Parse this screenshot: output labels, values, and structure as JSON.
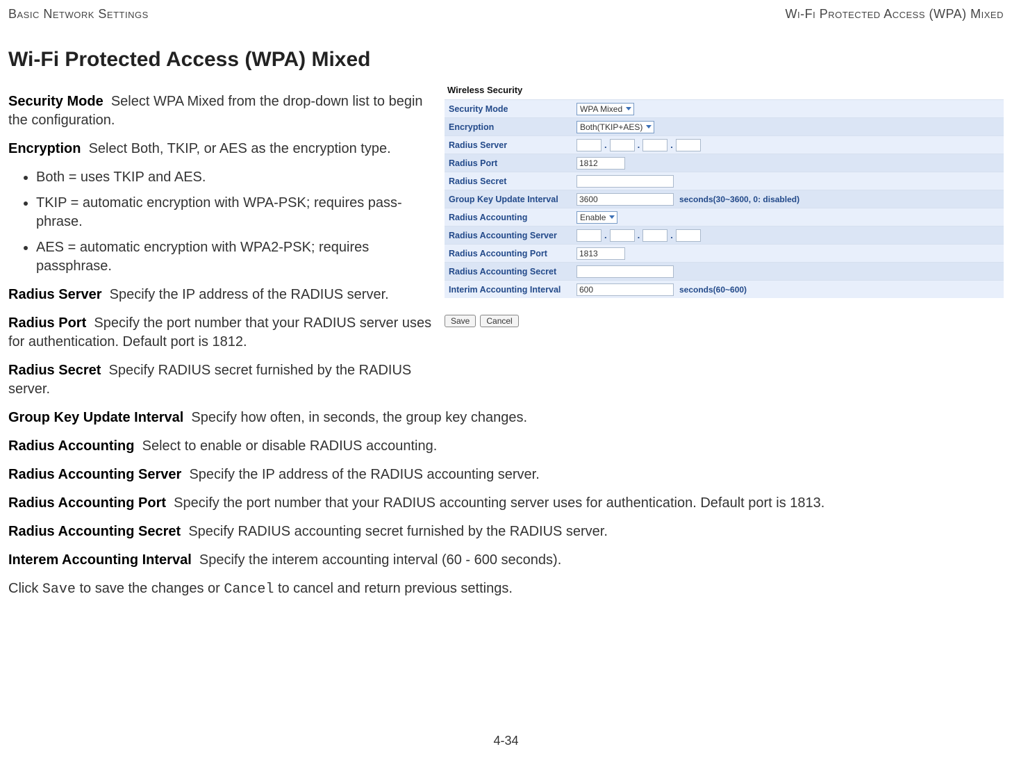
{
  "header": {
    "left": "Basic Network Settings",
    "right": "Wi-Fi Protected Access (WPA) Mixed"
  },
  "title": "Wi-Fi Protected Access (WPA) Mixed",
  "definitions": {
    "security_mode": {
      "term": "Security Mode",
      "desc": "Select WPA Mixed from the drop-down list to begin the configuration."
    },
    "encryption": {
      "term": "Encryption",
      "desc": "Select Both, TKIP, or AES as the encryption type."
    },
    "enc_items": [
      "Both = uses TKIP and AES.",
      "TKIP = automatic encryption with WPA-PSK; requires pass-phrase.",
      "AES = automatic encryption with WPA2-PSK; requires passphrase."
    ],
    "radius_server": {
      "term": "Radius Server",
      "desc": "Specify the IP address of the RADIUS server."
    },
    "radius_port": {
      "term": "Radius Port",
      "desc": "Specify the port number that your RADIUS server uses for authentication. Default port is 1812."
    },
    "radius_secret": {
      "term": "Radius Secret",
      "desc": "Specify RADIUS secret furnished by the RADIUS server."
    },
    "group_key": {
      "term": "Group Key Update Interval",
      "desc": "Specify how often, in seconds, the group key changes."
    },
    "radius_acct": {
      "term": "Radius Accounting",
      "desc": "Select to enable or disable RADIUS accounting."
    },
    "radius_acct_server": {
      "term": "Radius Accounting Server",
      "desc": "Specify the IP address of the RADIUS accounting server."
    },
    "radius_acct_port": {
      "term": "Radius Accounting Port",
      "desc": "Specify the port number that your RADIUS accounting server uses for authentication. Default port is 1813."
    },
    "radius_acct_secret": {
      "term": "Radius Accounting Secret",
      "desc": "Specify RADIUS accounting secret furnished by the RADIUS server."
    },
    "interem": {
      "term": "Interem Accounting Interval",
      "desc": "Specify the interem accounting interval (60 - 600 seconds)."
    },
    "closing_pre": "Click ",
    "closing_save": "Save",
    "closing_mid": " to save the changes or ",
    "closing_cancel": "Cancel",
    "closing_post": " to cancel and return previous settings."
  },
  "screenshot": {
    "panel_title": "Wireless Security",
    "rows": {
      "security_mode": {
        "label": "Security Mode",
        "value": "WPA Mixed"
      },
      "encryption": {
        "label": "Encryption",
        "value": "Both(TKIP+AES)"
      },
      "radius_server": {
        "label": "Radius Server"
      },
      "radius_port": {
        "label": "Radius Port",
        "value": "1812"
      },
      "radius_secret": {
        "label": "Radius Secret"
      },
      "group_key": {
        "label": "Group Key Update Interval",
        "value": "3600",
        "suffix": "seconds(30~3600, 0: disabled)"
      },
      "radius_acct": {
        "label": "Radius Accounting",
        "value": "Enable"
      },
      "radius_acct_server": {
        "label": "Radius Accounting Server"
      },
      "radius_acct_port": {
        "label": "Radius Accounting Port",
        "value": "1813"
      },
      "radius_acct_secret": {
        "label": "Radius Accounting Secret"
      },
      "interim": {
        "label": "Interim Accounting Interval",
        "value": "600",
        "suffix": "seconds(60~600)"
      }
    },
    "buttons": {
      "save": "Save",
      "cancel": "Cancel"
    }
  },
  "ip_dot": ".",
  "page_number": "4-34"
}
